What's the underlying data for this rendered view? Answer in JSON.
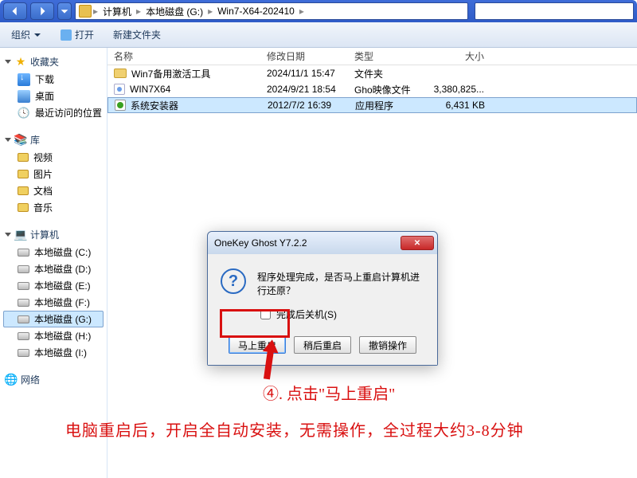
{
  "breadcrumb": {
    "seg1": "计算机",
    "seg2": "本地磁盘 (G:)",
    "seg3": "Win7-X64-202410"
  },
  "toolbar": {
    "organize": "组织",
    "open": "打开",
    "newfolder": "新建文件夹"
  },
  "sidebar": {
    "fav_head": "收藏夹",
    "fav_download": "下载",
    "fav_desktop": "桌面",
    "fav_recent": "最近访问的位置",
    "lib_head": "库",
    "lib_video": "视频",
    "lib_pic": "图片",
    "lib_doc": "文档",
    "lib_music": "音乐",
    "comp_head": "计算机",
    "drive_c": "本地磁盘 (C:)",
    "drive_d": "本地磁盘 (D:)",
    "drive_e": "本地磁盘 (E:)",
    "drive_f": "本地磁盘 (F:)",
    "drive_g": "本地磁盘 (G:)",
    "drive_h": "本地磁盘 (H:)",
    "drive_i": "本地磁盘 (I:)",
    "net_head": "网络"
  },
  "columns": {
    "name": "名称",
    "date": "修改日期",
    "type": "类型",
    "size": "大小"
  },
  "files": [
    {
      "name": "Win7备用激活工具",
      "date": "2024/11/1 15:47",
      "type": "文件夹",
      "size": ""
    },
    {
      "name": "WIN7X64",
      "date": "2024/9/21 18:54",
      "type": "Gho映像文件",
      "size": "3,380,825..."
    },
    {
      "name": "系统安装器",
      "date": "2012/7/2 16:39",
      "type": "应用程序",
      "size": "6,431 KB"
    }
  ],
  "dialog": {
    "title": "OneKey Ghost Y7.2.2",
    "message": "程序处理完成，是否马上重启计算机进行还原？",
    "checkbox": "完成后关机(S)",
    "btn_restart": "马上重启",
    "btn_later": "稍后重启",
    "btn_cancel": "撤销操作"
  },
  "annotation": {
    "step": "④. 点击\"马上重启\"",
    "note": "电脑重启后，开启全自动安装，无需操作，全过程大约3-8分钟"
  }
}
